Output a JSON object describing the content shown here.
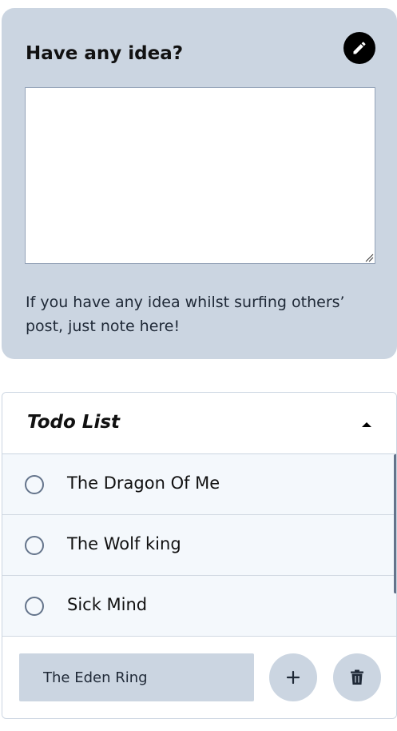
{
  "idea": {
    "title": "Have any idea?",
    "edit_icon": "pencil-icon",
    "textarea_value": "",
    "hint": "If you have any idea whilst surfing others’ post, just note here!"
  },
  "todo": {
    "title": "Todo List",
    "collapse_icon": "caret-up-icon",
    "items": [
      {
        "label": "The Dragon Of Me",
        "checked": false
      },
      {
        "label": "The Wolf king",
        "checked": false
      },
      {
        "label": "Sick Mind",
        "checked": false
      }
    ],
    "input_value": "The Eden Ring",
    "add_icon": "plus-icon",
    "delete_icon": "trash-icon"
  },
  "colors": {
    "card_background": "#cbd5e1",
    "list_background": "#f4f8fc",
    "border": "#cbd5e1",
    "radio_border": "#64748b",
    "icon_dark": "#000000"
  }
}
